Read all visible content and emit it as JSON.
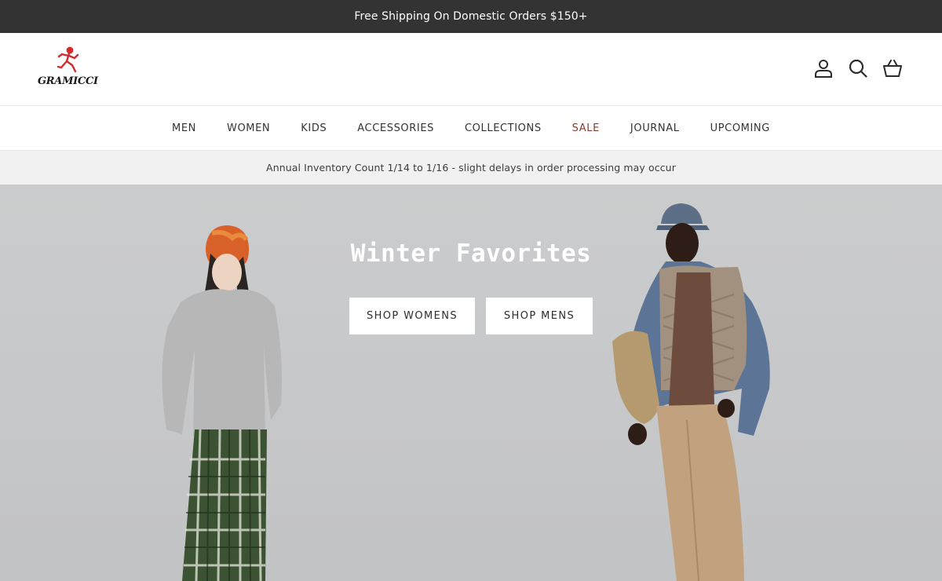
{
  "promo": {
    "text": "Free Shipping On Domestic Orders $150+"
  },
  "header": {
    "logo_text": "GRAMICCI",
    "icons": [
      "account-icon",
      "search-icon",
      "basket-icon"
    ]
  },
  "nav": {
    "items": [
      {
        "label": "MEN"
      },
      {
        "label": "WOMEN"
      },
      {
        "label": "KIDS"
      },
      {
        "label": "ACCESSORIES"
      },
      {
        "label": "COLLECTIONS"
      },
      {
        "label": "SALE",
        "color": "#8b3a2e"
      },
      {
        "label": "JOURNAL"
      },
      {
        "label": "UPCOMING"
      }
    ]
  },
  "notice": {
    "text": "Annual Inventory Count 1/14 to 1/16 - slight delays in order processing may occur"
  },
  "hero": {
    "title": "Winter Favorites",
    "buttons": [
      {
        "label": "SHOP WOMENS"
      },
      {
        "label": "SHOP MENS"
      }
    ]
  },
  "colors": {
    "promo_bg": "#333333",
    "notice_bg": "#f1f1f1",
    "sale_accent": "#8b3a2e",
    "logo_red": "#d22b2b",
    "hero_bg": "#c8c9cb"
  }
}
